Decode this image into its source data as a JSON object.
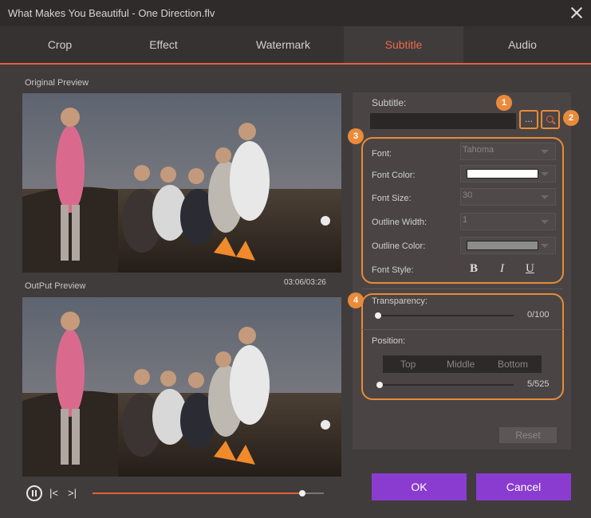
{
  "window": {
    "title": "What Makes You Beautiful - One Direction.flv"
  },
  "tabs": [
    {
      "label": "Crop"
    },
    {
      "label": "Effect"
    },
    {
      "label": "Watermark"
    },
    {
      "label": "Subtitle",
      "active": true
    },
    {
      "label": "Audio"
    }
  ],
  "preview": {
    "original_label": "Original Preview",
    "output_label": "OutPut Preview",
    "timecode": "03:06/03:26",
    "progress_fraction": 0.906
  },
  "subtitle": {
    "label": "Subtitle:",
    "value": "",
    "browse_label": "...",
    "badges": [
      "1",
      "2",
      "3",
      "4"
    ]
  },
  "font_settings": {
    "font_label": "Font:",
    "font_value": "Tahoma",
    "font_color_label": "Font Color:",
    "font_color": "#ffffff",
    "font_size_label": "Font Size:",
    "font_size_value": "30",
    "outline_width_label": "Outline Width:",
    "outline_width_value": "1",
    "outline_color_label": "Outline Color:",
    "outline_color": "#8c8c8c",
    "font_style_label": "Font Style:",
    "bold_label": "B",
    "italic_label": "I",
    "underline_label": "U"
  },
  "transparency": {
    "label": "Transparency:",
    "value_text": "0/100",
    "fraction": 0.0
  },
  "position": {
    "label": "Position:",
    "options": [
      "Top",
      "Middle",
      "Bottom"
    ],
    "value_text": "5/525",
    "fraction": 0.01
  },
  "buttons": {
    "reset": "Reset",
    "ok": "OK",
    "cancel": "Cancel"
  },
  "colors": {
    "accent": "#e0603f",
    "badge": "#ea8a3b",
    "primary_button": "#8a3bd0"
  },
  "icons": {
    "close": "close-icon",
    "play_pause": "pause-icon",
    "prev": "prev-frame-icon",
    "next": "next-frame-icon",
    "search": "search-icon"
  }
}
